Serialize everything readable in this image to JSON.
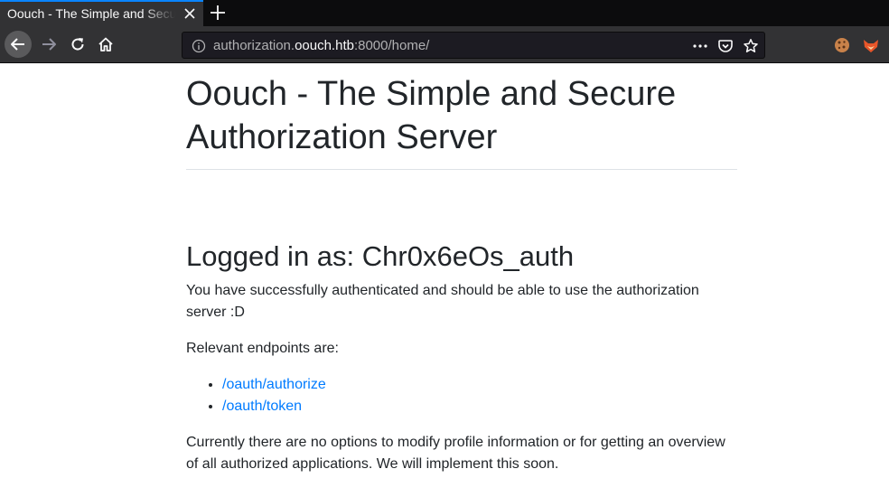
{
  "browser": {
    "tab_title": "Oouch - The Simple and Secure Authorization Server",
    "url_prefix": "authorization.",
    "url_host": "oouch.htb",
    "url_suffix": ":8000/home/"
  },
  "page": {
    "title": "Oouch - The Simple and Secure Authorization Server",
    "logged_in_label": "Logged in as: Chr0x6eOs_auth",
    "auth_message": "You have successfully authenticated and should be able to use the authorization server :D",
    "endpoints_intro": "Relevant endpoints are:",
    "endpoints": [
      {
        "label": "/oauth/authorize"
      },
      {
        "label": "/oauth/token"
      }
    ],
    "note": "Currently there are no options to modify profile information or for getting an overview of all authorized applications. We will implement this soon."
  },
  "colors": {
    "accent": "#0a84ff",
    "link": "#007bff",
    "text": "#212529"
  },
  "icons": [
    "close-icon",
    "plus-icon",
    "back-arrow-icon",
    "forward-arrow-icon",
    "reload-icon",
    "home-icon",
    "info-icon",
    "more-icon",
    "pocket-icon",
    "star-icon",
    "cookie-extension-icon",
    "fox-extension-icon"
  ]
}
